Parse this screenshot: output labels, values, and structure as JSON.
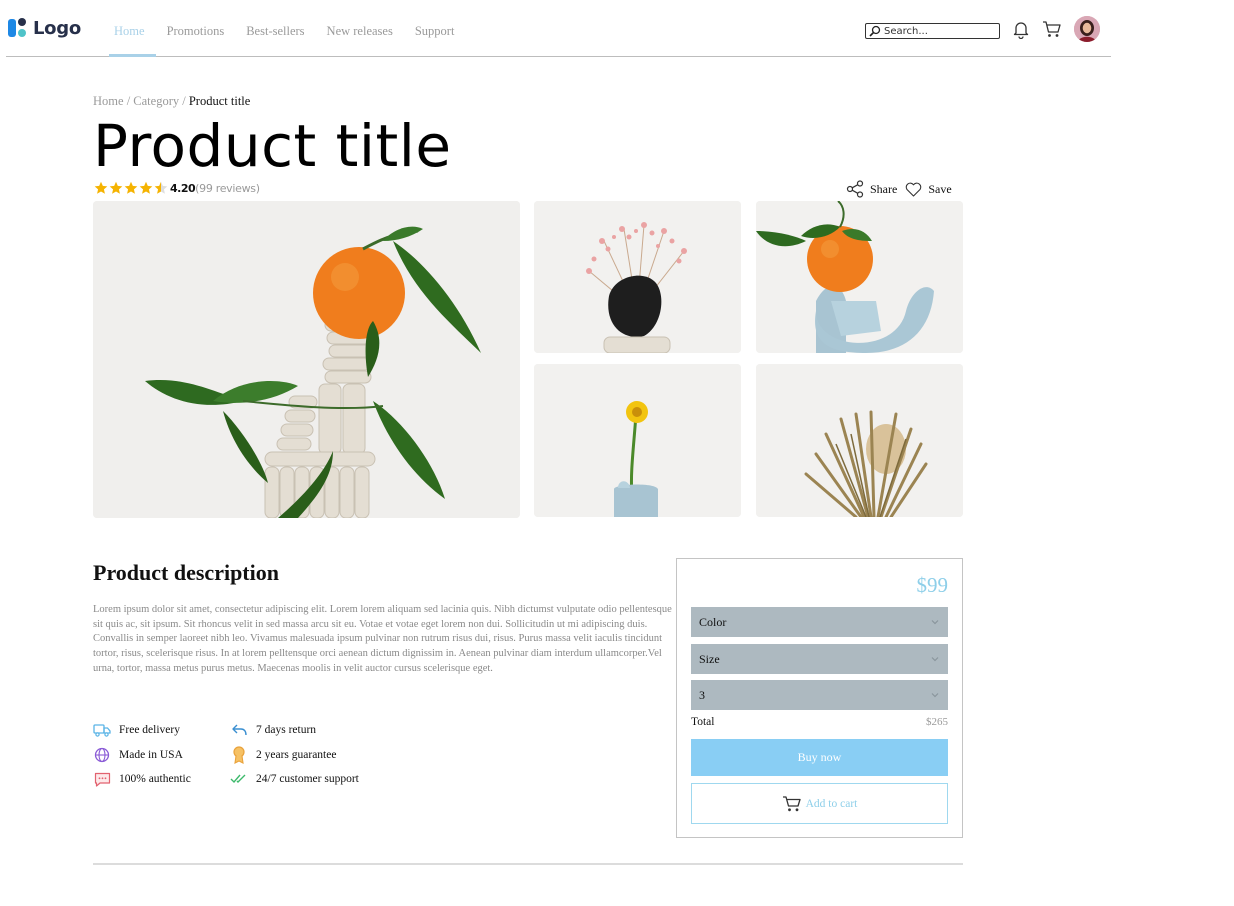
{
  "header": {
    "logo_text": "Logo",
    "nav": [
      {
        "label": "Home",
        "active": true
      },
      {
        "label": "Promotions",
        "active": false
      },
      {
        "label": "Best-sellers",
        "active": false
      },
      {
        "label": "New releases",
        "active": false
      },
      {
        "label": "Support",
        "active": false
      }
    ],
    "search": {
      "placeholder": "Search..."
    },
    "icons": [
      "search-icon",
      "bell-icon",
      "cart-icon",
      "avatar"
    ]
  },
  "breadcrumb": {
    "home": "Home",
    "separator": "/",
    "category": "Category",
    "current": "Product title"
  },
  "product": {
    "title": "Product title",
    "rating": 4.5,
    "rating_value": "4.20",
    "rating_count": "(99 reviews)",
    "share_label": "Share",
    "save_label": "Save"
  },
  "description": {
    "title": "Product description",
    "paragraph_1": "Lorem ipsum dolor sit amet, consectetur adipiscing elit. Lorem lorem aliquam sed lacinia quis. Nibh dictumst vulputate odio pellentesque sit quis ac, sit ipsum. Sit rhoncus velit in sed massa arcu sit eu. Votae et votae eget lorem non dui. Sollicitudin ut mi adipiscing duis.",
    "paragraph_2": "Convallis in semper laoreet nibh leo. Vivamus malesuada ipsum pulvinar non rutrum risus dui, risus. Purus massa velit iaculis tincidunt tortor, risus, scelerisque risus. In at lorem pelltensque orci aenean dictum dignissim in. Aenean pulvinar diam interdum ullamcorper.Vel urna, tortor, massa metus purus metus. Maecenas moolis in velit auctor cursus scelerisque eget."
  },
  "features": [
    {
      "label": "Free delivery",
      "icon": "truck-icon",
      "color": "#5ab4e6"
    },
    {
      "label": "7 days return",
      "icon": "return-arrow-icon",
      "color": "#3a8fd1"
    },
    {
      "label": "Made in USA",
      "icon": "globe-icon",
      "color": "#8a5bd6"
    },
    {
      "label": "2 years guarantee",
      "icon": "award-icon",
      "color": "#e9a23b"
    },
    {
      "label": "100% authentic",
      "icon": "chat-icon",
      "color": "#e2626f"
    },
    {
      "label": "24/7 customer support",
      "icon": "double-check-icon",
      "color": "#3cb96b"
    }
  ],
  "purchase": {
    "price": "$99",
    "color_select": "Color",
    "size_select": "Size",
    "quantity_select": "3",
    "total_label": "Total",
    "total_value": "$265",
    "buy_label": "Buy now",
    "cart_label": "Add to cart"
  },
  "colors": {
    "accent": "#89cef4",
    "nav_active": "#a9d1e8",
    "select_bg": "#adb9c0",
    "star": "#f5b301"
  }
}
